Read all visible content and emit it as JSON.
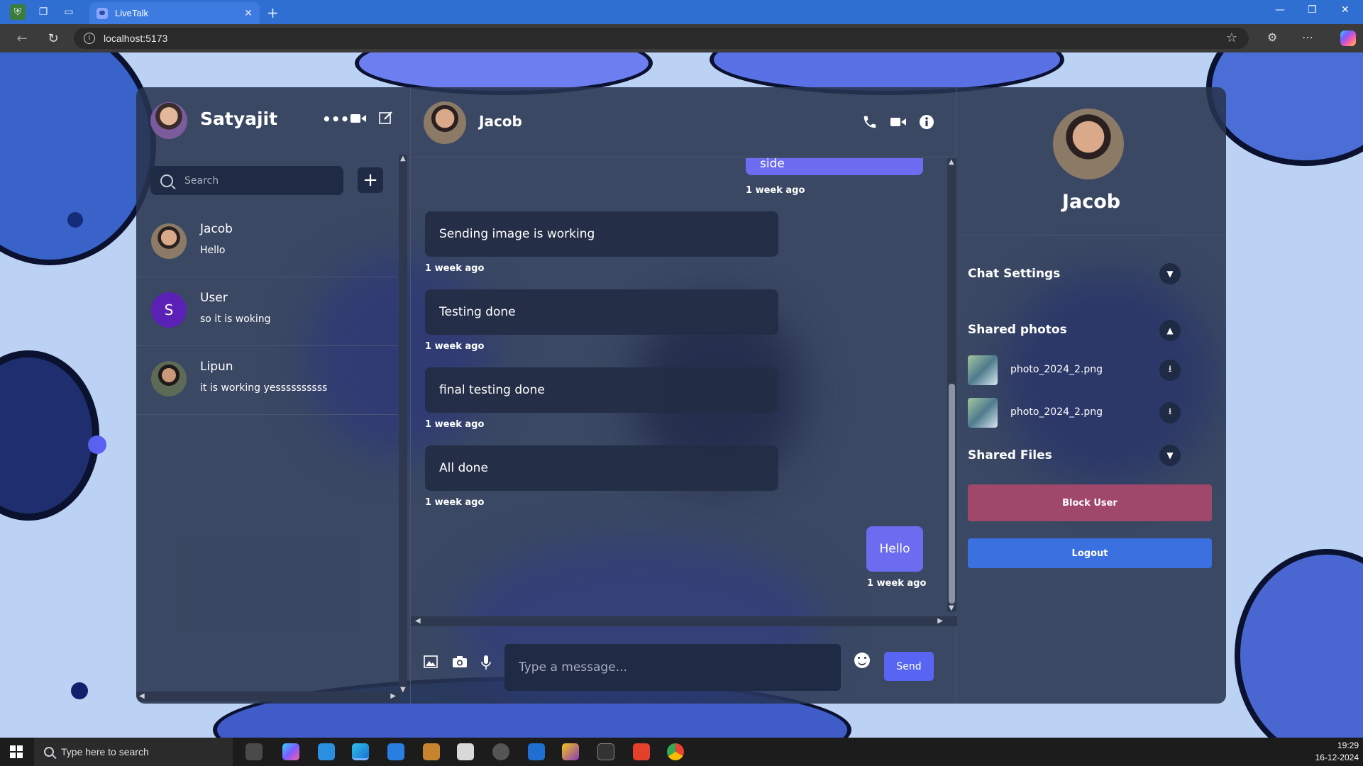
{
  "browser": {
    "tab_title": "LiveTalk",
    "tab_close": "✕",
    "new_tab": "+",
    "url": "localhost:5173"
  },
  "app": {
    "current_user": {
      "name": "Satyajit"
    },
    "search": {
      "placeholder": "Search",
      "value": ""
    },
    "add_label": "+",
    "chats": [
      {
        "name": "Jacob",
        "last_message": "Hello",
        "avatar_type": "photo"
      },
      {
        "name": "User",
        "last_message": "so it is woking",
        "avatar_type": "letter",
        "avatar_letter": "S",
        "avatar_color": "#5b21b6"
      },
      {
        "name": "Lipun",
        "last_message": "it is working yessssssssss",
        "avatar_type": "photo"
      }
    ],
    "active_chat": {
      "name": "Jacob",
      "messages": [
        {
          "text": "testing done from this side",
          "time": "1 week ago",
          "own": true
        },
        {
          "text": "Sending image is working",
          "time": "1 week ago",
          "own": false
        },
        {
          "text": "Testing done",
          "time": "1 week ago",
          "own": false
        },
        {
          "text": "final testing done",
          "time": "1 week ago",
          "own": false
        },
        {
          "text": "All done",
          "time": "1 week ago",
          "own": false
        },
        {
          "text": "Hello",
          "time": "1 week ago",
          "own": true
        }
      ]
    },
    "composer": {
      "placeholder": "Type a message...",
      "value": "",
      "send_label": "Send"
    },
    "detail": {
      "name": "Jacob",
      "sections": {
        "chat_settings": "Chat Settings",
        "shared_photos": "Shared photos",
        "shared_files": "Shared Files"
      },
      "photos": [
        {
          "name": "photo_2024_2.png"
        },
        {
          "name": "photo_2024_2.png"
        }
      ],
      "block_label": "Block User",
      "logout_label": "Logout"
    }
  },
  "taskbar": {
    "search_placeholder": "Type here to search",
    "time": "19:29",
    "date": "16-12-2024"
  },
  "colors": {
    "accent": "#5865f2",
    "own_message": "#6c6cf0",
    "block": "#a0486b",
    "logout": "#3b70e0",
    "tab_bar": "#2f6fd1"
  }
}
